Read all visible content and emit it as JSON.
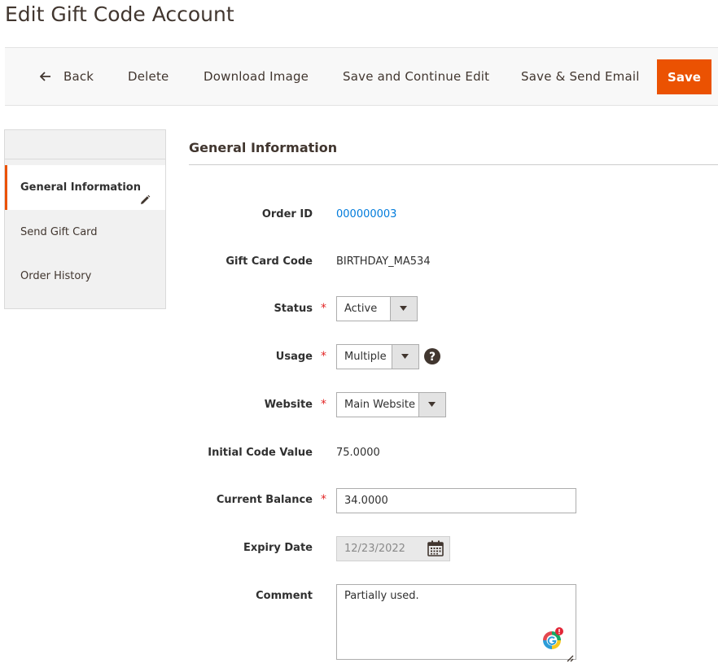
{
  "page": {
    "title": "Edit Gift Code Account"
  },
  "toolbar": {
    "back_label": "Back",
    "delete_label": "Delete",
    "download_label": "Download Image",
    "save_continue_label": "Save and Continue Edit",
    "save_send_label": "Save & Send Email",
    "save_label": "Save"
  },
  "sidebar": {
    "items": [
      {
        "label": "General Information",
        "active": true
      },
      {
        "label": "Send Gift Card"
      },
      {
        "label": "Order History"
      }
    ]
  },
  "section": {
    "title": "General Information"
  },
  "form": {
    "order_id": {
      "label": "Order ID",
      "value": "000000003"
    },
    "gift_card_code": {
      "label": "Gift Card Code",
      "value": "BIRTHDAY_MA534"
    },
    "status": {
      "label": "Status",
      "value": "Active"
    },
    "usage": {
      "label": "Usage",
      "value": "Multiple"
    },
    "website": {
      "label": "Website",
      "value": "Main Website"
    },
    "initial_value": {
      "label": "Initial Code Value",
      "value": "75.0000"
    },
    "current_balance": {
      "label": "Current Balance",
      "value": "34.0000"
    },
    "expiry_date": {
      "label": "Expiry Date",
      "value": "12/23/2022"
    },
    "comment": {
      "label": "Comment",
      "value": "Partially used."
    },
    "required_mark": "*"
  },
  "colors": {
    "accent": "#eb5202",
    "link": "#007bdb",
    "required": "#e22626"
  },
  "icons": {
    "back": "arrow-left-icon",
    "edit": "pencil-icon",
    "dropdown": "caret-down-icon",
    "help": "question-circle-icon",
    "calendar": "calendar-icon",
    "grammarly": "grammarly-icon"
  }
}
